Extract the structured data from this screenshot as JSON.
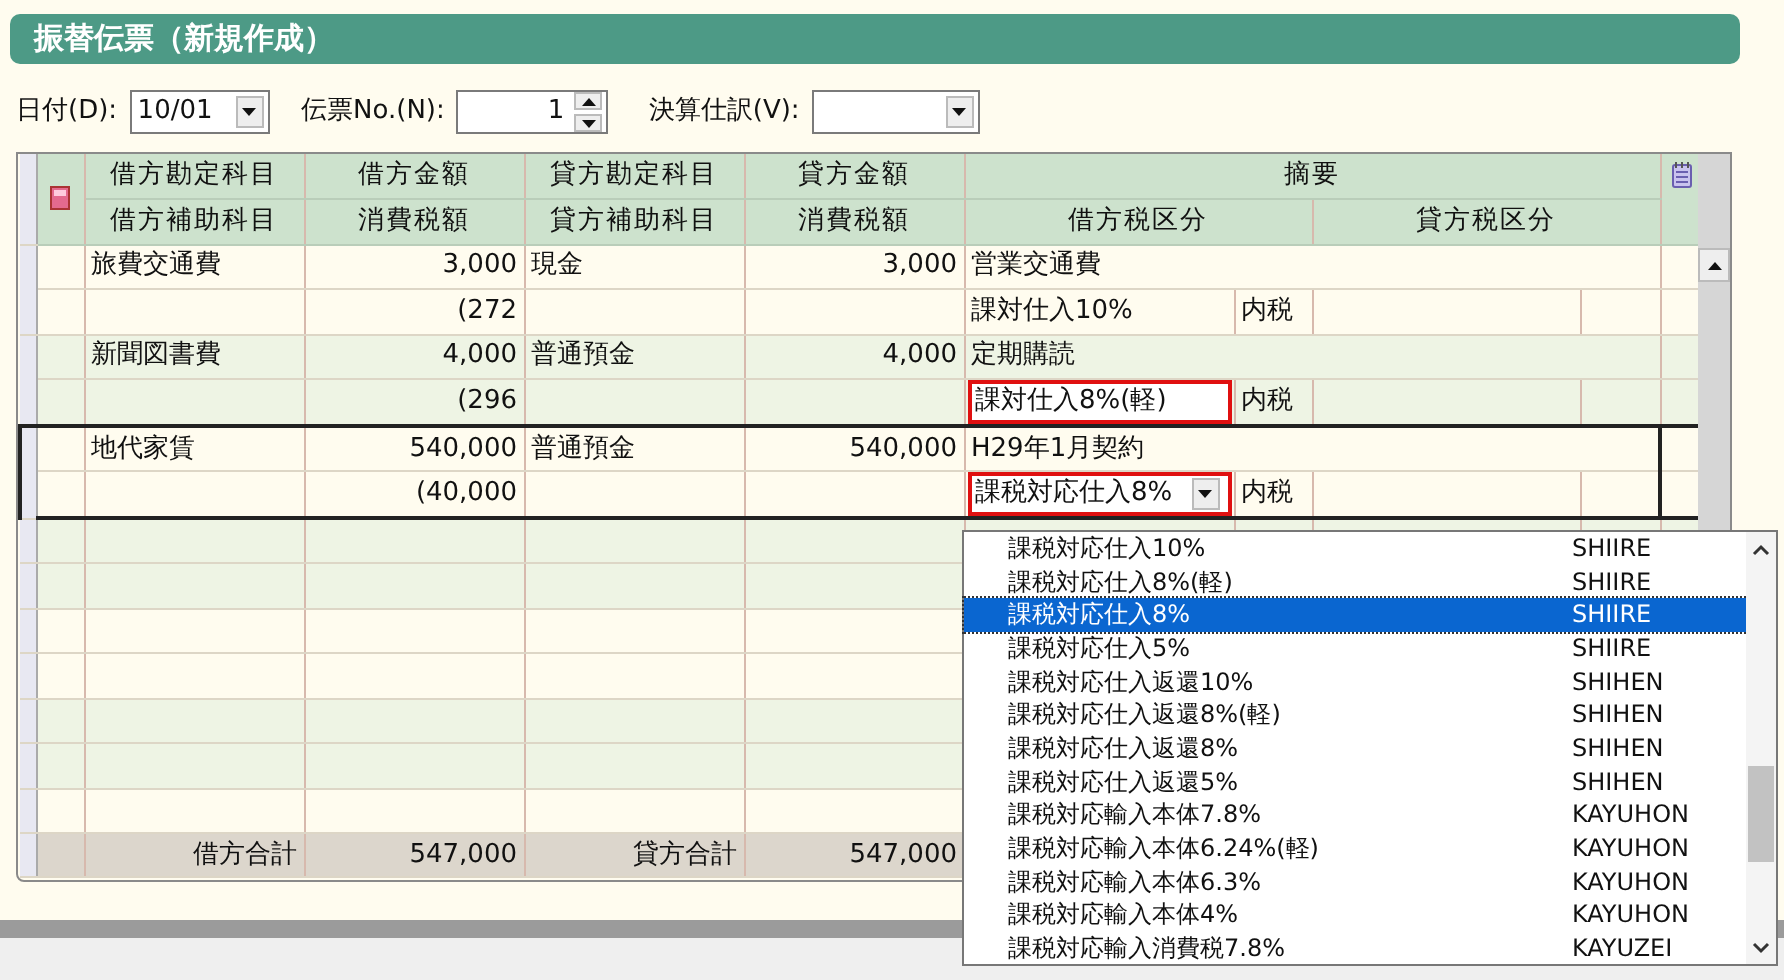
{
  "title": "振替伝票（新規作成）",
  "form": {
    "date": {
      "label": "日付(D):",
      "value": "10/01"
    },
    "slip_no": {
      "label": "伝票No.(N):",
      "value": "1"
    },
    "closing": {
      "label": "決算仕訳(V):"
    }
  },
  "table": {
    "header_top": [
      "借方勘定科目",
      "借方金額",
      "貸方勘定科目",
      "貸方金額",
      "摘要"
    ],
    "header_bottom": [
      "借方補助科目",
      "消費税額",
      "貸方補助科目",
      "消費税額",
      "借方税区分",
      "貸方税区分"
    ],
    "entries": [
      {
        "debit_account": "旅費交通費",
        "debit_amount": "3,000",
        "credit_account": "現金",
        "credit_amount": "3,000",
        "summary": "営業交通費",
        "debit_tax": "(272",
        "tax_category": "課対仕入10%",
        "kind": "text",
        "tax_highlight": false,
        "tax_type": "内税",
        "selected": false
      },
      {
        "debit_account": "新聞図書費",
        "debit_amount": "4,000",
        "credit_account": "普通預金",
        "credit_amount": "4,000",
        "summary": "定期購読",
        "debit_tax": "(296",
        "tax_category": "課対仕入8%(軽)",
        "kind": "text",
        "tax_highlight": true,
        "tax_type": "内税",
        "selected": false
      },
      {
        "debit_account": "地代家賃",
        "debit_amount": "540,000",
        "credit_account": "普通預金",
        "credit_amount": "540,000",
        "summary": "H29年1月契約",
        "debit_tax": "(40,000",
        "tax_category": "課税対応仕入8%",
        "kind": "combo",
        "tax_highlight": true,
        "tax_type": "内税",
        "selected": true
      }
    ],
    "totals": {
      "debit_label": "借方合計",
      "debit_total": "547,000",
      "credit_label": "貸方合計",
      "credit_total": "547,000"
    }
  },
  "tax_dropdown": [
    {
      "label": "課税対応仕入10%",
      "code": "SHIIRE",
      "selected": false
    },
    {
      "label": "課税対応仕入8%(軽)",
      "code": "SHIIRE",
      "selected": false
    },
    {
      "label": "課税対応仕入8%",
      "code": "SHIIRE",
      "selected": true
    },
    {
      "label": "課税対応仕入5%",
      "code": "SHIIRE",
      "selected": false
    },
    {
      "label": "課税対応仕入返還10%",
      "code": "SHIHEN",
      "selected": false
    },
    {
      "label": "課税対応仕入返還8%(軽)",
      "code": "SHIHEN",
      "selected": false
    },
    {
      "label": "課税対応仕入返還8%",
      "code": "SHIHEN",
      "selected": false
    },
    {
      "label": "課税対応仕入返還5%",
      "code": "SHIHEN",
      "selected": false
    },
    {
      "label": "課税対応輸入本体7.8%",
      "code": "KAYUHON",
      "selected": false
    },
    {
      "label": "課税対応輸入本体6.24%(軽)",
      "code": "KAYUHON",
      "selected": false
    },
    {
      "label": "課税対応輸入本体6.3%",
      "code": "KAYUHON",
      "selected": false
    },
    {
      "label": "課税対応輸入本体4%",
      "code": "KAYUHON",
      "selected": false
    },
    {
      "label": "課税対応輸入消費税7.8%",
      "code": "KAYUZEI",
      "selected": false
    }
  ]
}
